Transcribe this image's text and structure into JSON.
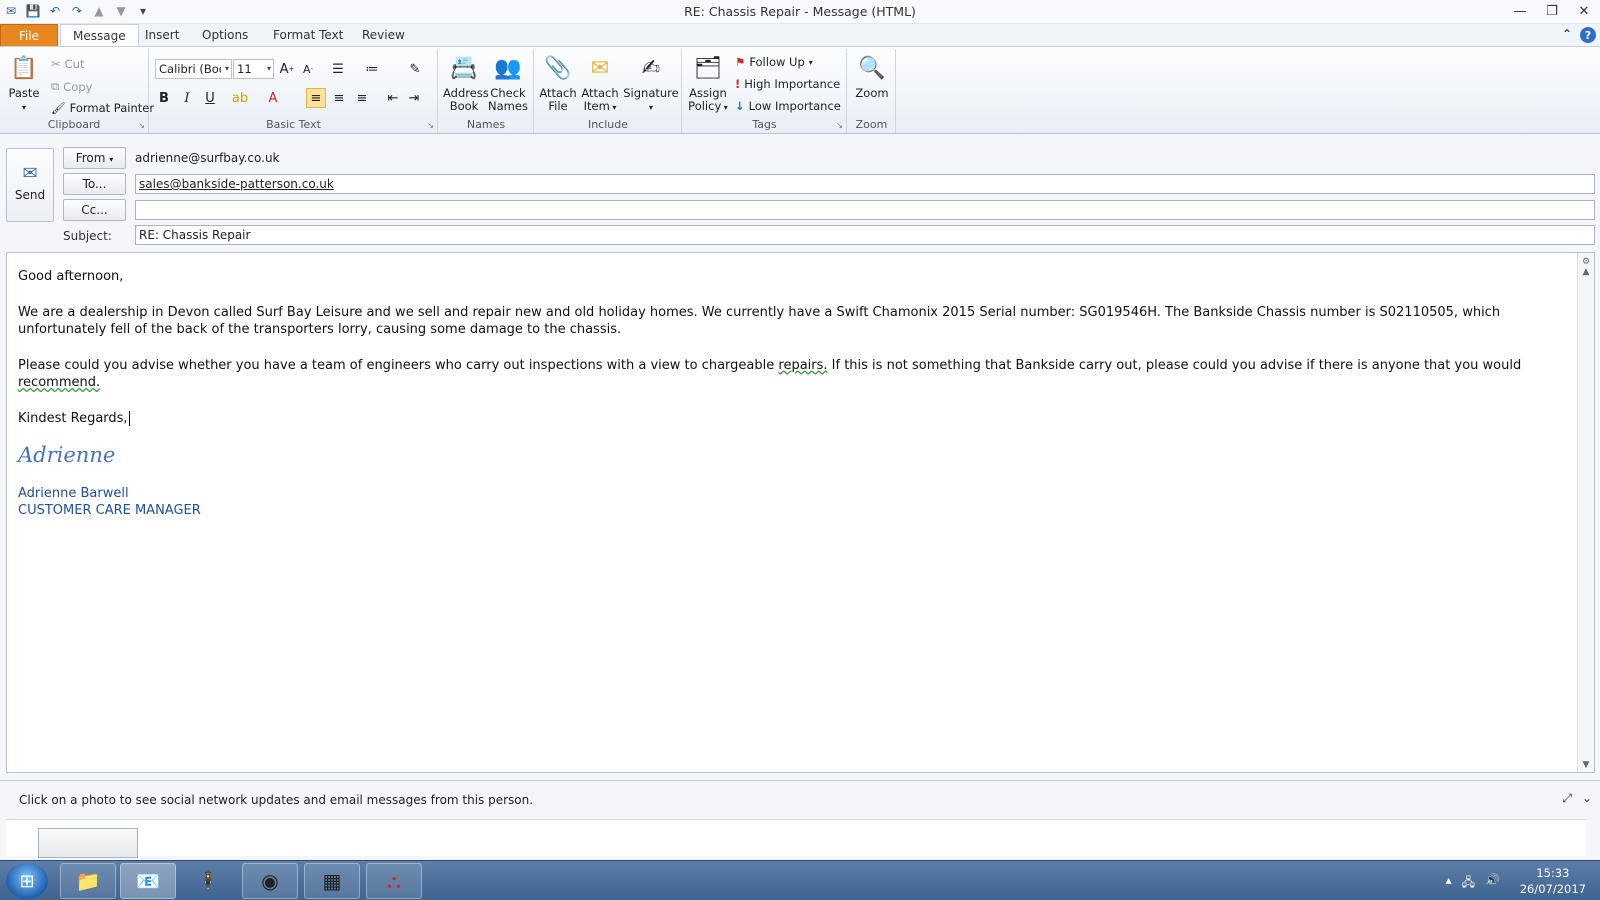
{
  "window": {
    "title": "RE: Chassis Repair  -  Message (HTML)"
  },
  "tabs": [
    {
      "label": "File"
    },
    {
      "label": "Message"
    },
    {
      "label": "Insert"
    },
    {
      "label": "Options"
    },
    {
      "label": "Format Text"
    },
    {
      "label": "Review"
    }
  ],
  "ribbon": {
    "clipboard": {
      "label": "Clipboard",
      "paste": "Paste",
      "cut": "Cut",
      "copy": "Copy",
      "format_painter": "Format Painter"
    },
    "basic_text": {
      "label": "Basic Text",
      "font": "Calibri (Body)",
      "size": "11",
      "bold": "B",
      "italic": "I",
      "underline": "U"
    },
    "names": {
      "label": "Names",
      "address_book_1": "Address",
      "address_book_2": "Book",
      "check_names_1": "Check",
      "check_names_2": "Names"
    },
    "include": {
      "label": "Include",
      "attach_file_1": "Attach",
      "attach_file_2": "File",
      "attach_item_1": "Attach",
      "attach_item_2": "Item",
      "signature": "Signature"
    },
    "tags": {
      "label": "Tags",
      "assign_policy_1": "Assign",
      "assign_policy_2": "Policy",
      "follow_up": "Follow Up",
      "high_importance": "High Importance",
      "low_importance": "Low Importance"
    },
    "zoom": {
      "label": "Zoom",
      "zoom": "Zoom"
    }
  },
  "compose": {
    "send": "Send",
    "from_label": "From",
    "from_value": "adrienne@surfbay.co.uk",
    "to_label": "To...",
    "to_value": "sales@bankside-patterson.co.uk",
    "cc_label": "Cc...",
    "cc_value": "",
    "subject_label": "Subject:",
    "subject_value": "RE: Chassis Repair"
  },
  "body": {
    "greeting": "Good afternoon,",
    "para1": "We are a dealership in Devon called Surf Bay Leisure and we sell and repair new and old holiday homes.  We currently have a Swift Chamonix 2015 Serial number: SG019546H.  The Bankside Chassis number is S02110505, which unfortunately fell of the back of the transporters lorry, causing some damage to the chassis.",
    "para2_a": "Please could you advise whether you have a team of engineers who carry out inspections with a view to chargeable ",
    "para2_b": "repairs.",
    "para2_c": "  If this is not something that Bankside carry out, please could you advise if there is anyone that you would ",
    "para2_d": "recommend.",
    "closing": "Kindest Regards,",
    "signature_script": "Adrienne",
    "sig_name": "Adrienne Barwell",
    "sig_title": "CUSTOMER CARE MANAGER"
  },
  "people_pane": {
    "message": "Click on a photo to see social network updates and email messages from this person."
  },
  "taskbar": {
    "time": "15:33",
    "date": "26/07/2017"
  }
}
